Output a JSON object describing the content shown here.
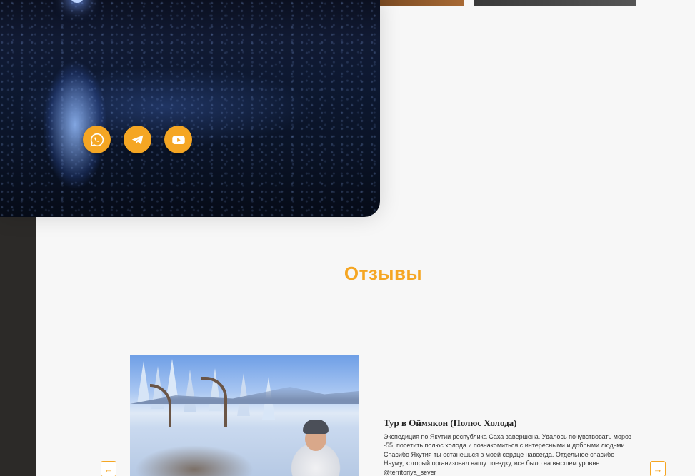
{
  "socials": {
    "items": [
      {
        "icon": "whatsapp-icon"
      },
      {
        "icon": "telegram-icon"
      },
      {
        "icon": "youtube-icon"
      }
    ],
    "accent_color": "#f5a623"
  },
  "reviews": {
    "section_title": "Отзывы",
    "current": {
      "title": "Тур в Оймякон (Полюс Холода)",
      "text": "Экспедиция по Якутии республика Саха завершена. Удалось почувствовать мороз -55, посетить полюс холода и познакомиться с интересными и добрыми людьми. Спасибо Якутия ты останешься в моей сердце навсегда. Отдельное спасибо Науму, который организовал нашу поездку, все было на высшем уровне @territoriya_sever"
    },
    "prev_arrow": "←",
    "next_arrow": "→"
  }
}
